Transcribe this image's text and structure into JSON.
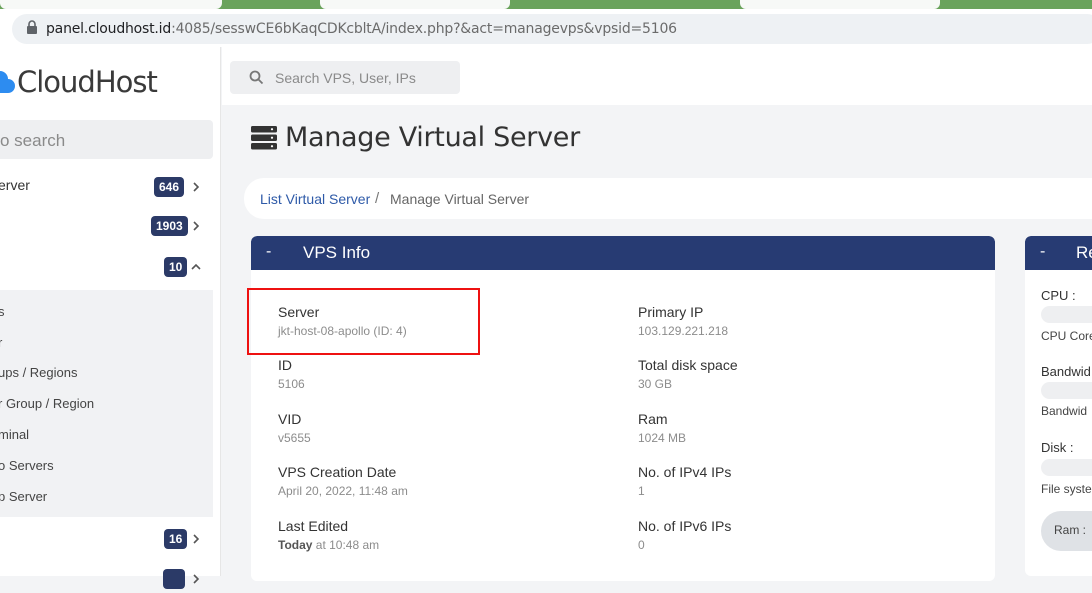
{
  "browser": {
    "url_host": "panel.cloudhost.id",
    "url_rest": ":4085/sesswCE6bKaqCDKcbltA/index.php?&act=managevps&vpsid=5106"
  },
  "sidebar": {
    "logo_text": "CloudHost",
    "search_placeholder": "o search",
    "items": [
      {
        "label": "erver",
        "badge": "646",
        "chevron": "chevron-right-icon"
      },
      {
        "label": "",
        "badge": "1903",
        "chevron": "chevron-right-icon"
      },
      {
        "label": "",
        "badge": "10",
        "chevron": "chevron-up-icon"
      }
    ],
    "submenu": [
      "s",
      "r",
      "ups / Regions",
      "r Group / Region",
      "minal",
      "o Servers",
      "p Server"
    ],
    "bottom_items": [
      {
        "label": "",
        "badge": "16",
        "chevron": "chevron-right-icon"
      },
      {
        "label": "",
        "badge": "",
        "chevron": "chevron-right-icon"
      }
    ]
  },
  "topbar": {
    "search_placeholder": "Search VPS, User, IPs"
  },
  "page": {
    "title": "Manage Virtual Server",
    "breadcrumb_link": "List Virtual Server",
    "breadcrumb_sep": "/",
    "breadcrumb_current": "Manage Virtual Server"
  },
  "vps_info": {
    "header_dash": "-",
    "header": "VPS Info",
    "left": [
      {
        "key": "Server",
        "value": "jkt-host-08-apollo (ID: 4)"
      },
      {
        "key": "ID",
        "value": "5106"
      },
      {
        "key": "VID",
        "value": "v5655"
      },
      {
        "key": "VPS Creation Date",
        "value": "April 20, 2022, 11:48 am"
      },
      {
        "key": "Last Edited",
        "value_bold": "Today",
        "value": " at 10:48 am"
      }
    ],
    "right": [
      {
        "key": "Primary IP",
        "value": "103.129.221.218"
      },
      {
        "key": "Total disk space",
        "value": "30 GB"
      },
      {
        "key": "Ram",
        "value": "1024 MB"
      },
      {
        "key": "No. of IPv4 IPs",
        "value": "1"
      },
      {
        "key": "No. of IPv6 IPs",
        "value": "0"
      }
    ]
  },
  "resources": {
    "header_dash": "-",
    "header": "Re",
    "cpu_label": "CPU :",
    "cpu_cores": "CPU Core",
    "bandwidth_label": "Bandwid",
    "bandwidth_sub": "Bandwid",
    "disk_label": "Disk :",
    "disk_sub": "File syste",
    "ram_pill": "Ram : "
  },
  "colors": {
    "accent": "#273b73",
    "link": "#2e5aa8",
    "highlight": "#ee1111"
  }
}
